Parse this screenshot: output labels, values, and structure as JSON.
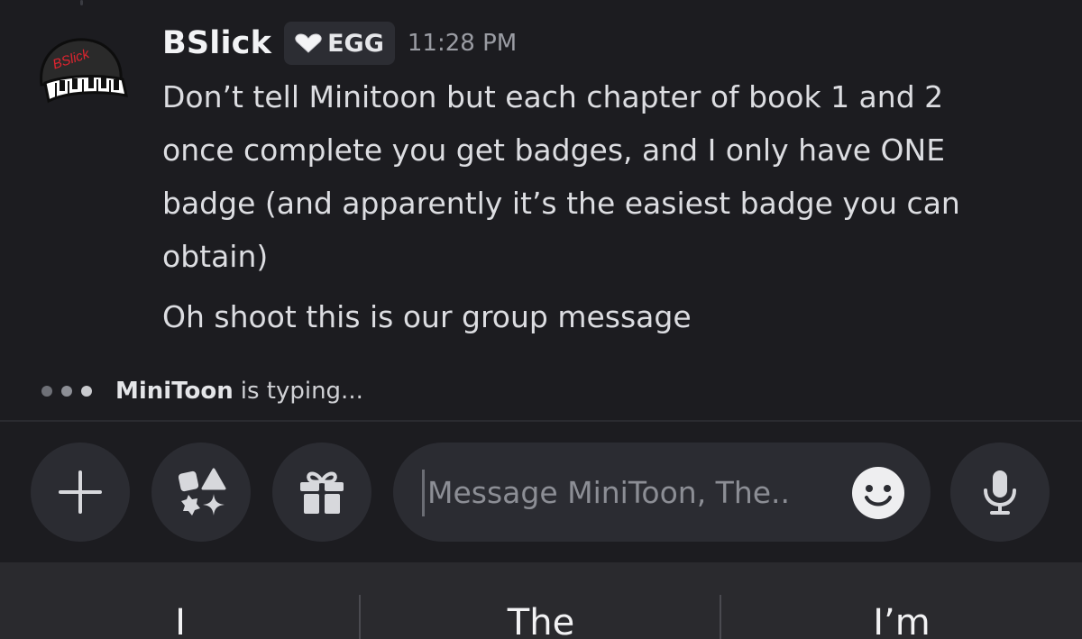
{
  "message": {
    "author": "BSlick",
    "tag_label": "EGG",
    "timestamp": "11:28 PM",
    "avatar_text": "BSlick",
    "lines": [
      "Don’t tell Minitoon but each chapter of book 1 and 2",
      "once complete you get badges, and I only have ONE",
      "badge (and apparently it’s the easiest badge you can",
      "obtain)"
    ],
    "second_message": "Oh shoot this is our group message"
  },
  "typing": {
    "name": "MiniToon",
    "rest": "is typing..."
  },
  "composer": {
    "placeholder": "Message MiniToon, The.."
  },
  "icons": {
    "add": "plus-icon",
    "apps": "apps-icon",
    "gift": "gift-icon",
    "emoji": "emoji-icon",
    "mic": "microphone-icon"
  },
  "keyboard": {
    "suggestions": [
      "I",
      "The",
      "I’m"
    ]
  },
  "colors": {
    "background": "#1c1c20",
    "surface": "#2b2c32",
    "text": "#dcdde1",
    "muted": "#8c8e95",
    "keyboard_bar": "#2a2a2e"
  }
}
